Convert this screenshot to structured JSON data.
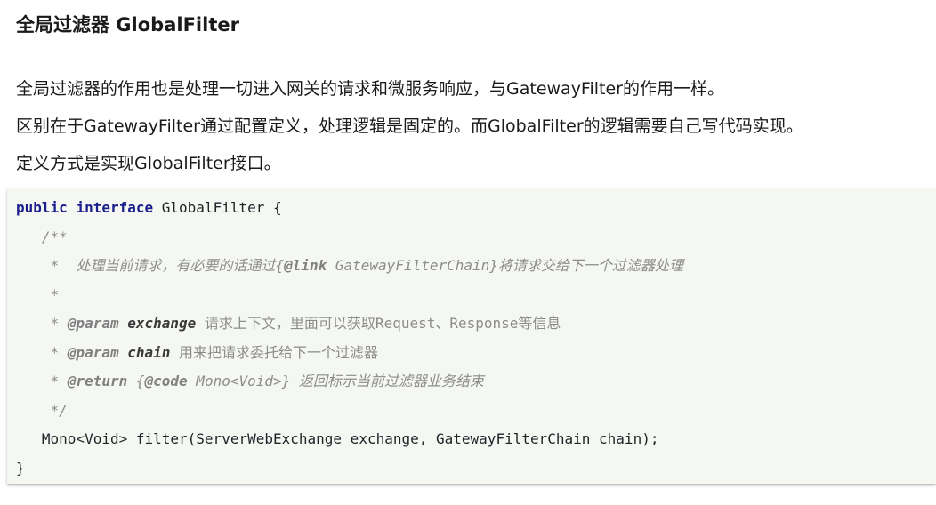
{
  "heading": "全局过滤器 GlobalFilter",
  "paragraphs": [
    "全局过滤器的作用也是处理一切进入网关的请求和微服务响应，与GatewayFilter的作用一样。",
    "区别在于GatewayFilter通过配置定义，处理逻辑是固定的。而GlobalFilter的逻辑需要自己写代码实现。",
    "定义方式是实现GlobalFilter接口。"
  ],
  "code": {
    "line1": {
      "kw1": "public",
      "kw2": "interface",
      "rest": " GlobalFilter {"
    },
    "line2": "   /**",
    "line3": {
      "prefix": "    *  处理当前请求，有必要的话通过{",
      "tag": "@link",
      "suffix": " GatewayFilterChain}将请求交给下一个过滤器处理"
    },
    "line4": "    *",
    "line5": {
      "prefix": "    * ",
      "tag": "@param",
      "space": " ",
      "pname": "exchange",
      "desc": " 请求上下文，里面可以获取Request、Response等信息"
    },
    "line6": {
      "prefix": "    * ",
      "tag": "@param",
      "space": " ",
      "pname": "chain",
      "desc": " 用来把请求委托给下一个过滤器"
    },
    "line7": {
      "prefix": "    * ",
      "tag": "@return",
      "mid": " {",
      "tag2": "@code",
      "suffix": " Mono<Void>} 返回标示当前过滤器业务结束"
    },
    "line8": "    */",
    "line9": "   Mono<Void> filter(ServerWebExchange exchange, GatewayFilterChain chain);",
    "line10": "}"
  }
}
